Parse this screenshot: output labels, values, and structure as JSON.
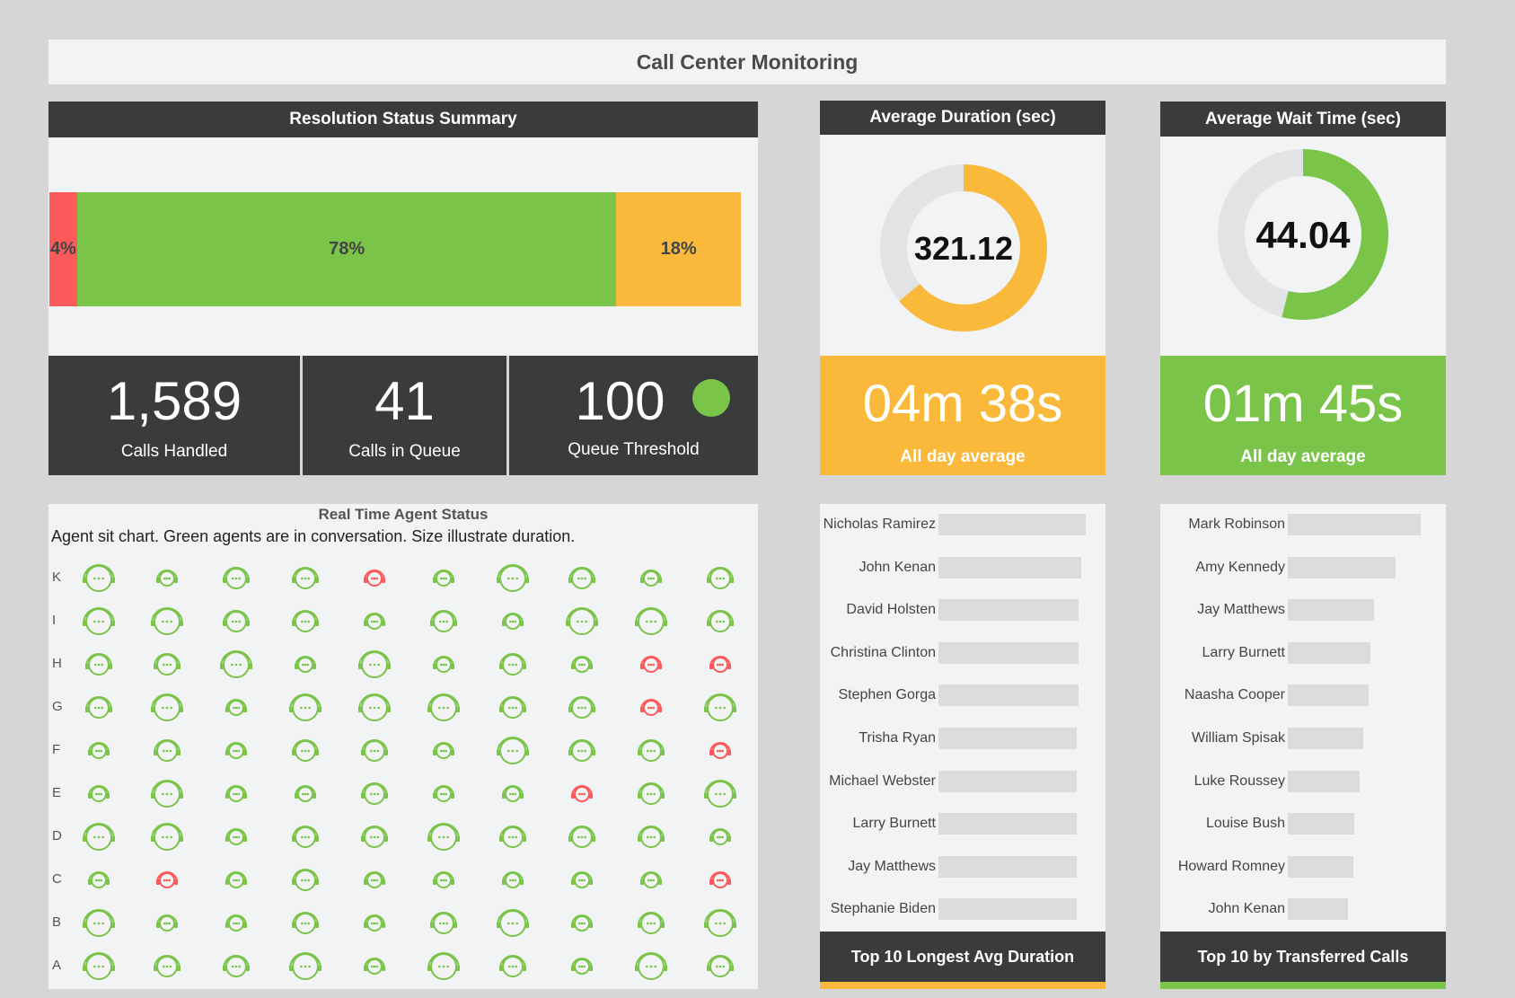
{
  "page_title": "Call Center Monitoring",
  "resolution": {
    "title": "Resolution Status Summary",
    "segments": [
      {
        "label": "4%",
        "value": 4,
        "color": "#fc5a5a"
      },
      {
        "label": "78%",
        "value": 78,
        "color": "#7ac44a"
      },
      {
        "label": "18%",
        "value": 18,
        "color": "#fbb93b"
      }
    ]
  },
  "kpis": {
    "calls_handled": {
      "value": "1,589",
      "label": "Calls Handled"
    },
    "calls_in_queue": {
      "value": "41",
      "label": "Calls in Queue"
    },
    "queue_threshold": {
      "value": "100",
      "label": "Queue Threshold",
      "status_color": "#7ac44a"
    }
  },
  "avg_duration": {
    "title": "Average Duration (sec)",
    "value": "321.12",
    "fraction": 0.64,
    "color": "#fbb93b",
    "time": "04m 38s",
    "time_label": "All day average"
  },
  "avg_wait": {
    "title": "Average Wait Time (sec)",
    "value": "44.04",
    "fraction": 0.54,
    "color": "#7ac44a",
    "time": "01m 45s",
    "time_label": "All day average"
  },
  "agents": {
    "title": "Real Time Agent Status",
    "subtitle": "Agent sit chart. Green agents are in conversation. Size illustrate duration.",
    "rows": [
      "K",
      "I",
      "H",
      "G",
      "F",
      "E",
      "D",
      "C",
      "B",
      "A"
    ],
    "grid": [
      [
        [
          "g",
          3
        ],
        [
          "g",
          1
        ],
        [
          "g",
          2
        ],
        [
          "g",
          2
        ],
        [
          "r",
          1
        ],
        [
          "g",
          1
        ],
        [
          "g",
          3
        ],
        [
          "g",
          2
        ],
        [
          "g",
          1
        ],
        [
          "g",
          2
        ]
      ],
      [
        [
          "g",
          3
        ],
        [
          "g",
          3
        ],
        [
          "g",
          2
        ],
        [
          "g",
          2
        ],
        [
          "g",
          1
        ],
        [
          "g",
          2
        ],
        [
          "g",
          1
        ],
        [
          "g",
          3
        ],
        [
          "g",
          3
        ],
        [
          "g",
          2
        ]
      ],
      [
        [
          "g",
          2
        ],
        [
          "g",
          2
        ],
        [
          "g",
          3
        ],
        [
          "g",
          1
        ],
        [
          "g",
          3
        ],
        [
          "g",
          1
        ],
        [
          "g",
          2
        ],
        [
          "g",
          1
        ],
        [
          "r",
          1
        ],
        [
          "r",
          1
        ]
      ],
      [
        [
          "g",
          2
        ],
        [
          "g",
          3
        ],
        [
          "g",
          1
        ],
        [
          "g",
          3
        ],
        [
          "g",
          3
        ],
        [
          "g",
          3
        ],
        [
          "g",
          2
        ],
        [
          "g",
          2
        ],
        [
          "r",
          1
        ],
        [
          "g",
          3
        ]
      ],
      [
        [
          "g",
          1
        ],
        [
          "g",
          2
        ],
        [
          "g",
          1
        ],
        [
          "g",
          2
        ],
        [
          "g",
          2
        ],
        [
          "g",
          1
        ],
        [
          "g",
          3
        ],
        [
          "g",
          2
        ],
        [
          "g",
          2
        ],
        [
          "r",
          1
        ]
      ],
      [
        [
          "g",
          1
        ],
        [
          "g",
          3
        ],
        [
          "g",
          1
        ],
        [
          "g",
          1
        ],
        [
          "g",
          2
        ],
        [
          "g",
          1
        ],
        [
          "g",
          1
        ],
        [
          "r",
          1
        ],
        [
          "g",
          2
        ],
        [
          "g",
          3
        ]
      ],
      [
        [
          "g",
          3
        ],
        [
          "g",
          3
        ],
        [
          "g",
          1
        ],
        [
          "g",
          2
        ],
        [
          "g",
          2
        ],
        [
          "g",
          3
        ],
        [
          "g",
          2
        ],
        [
          "g",
          2
        ],
        [
          "g",
          2
        ],
        [
          "g",
          1
        ]
      ],
      [
        [
          "g",
          1
        ],
        [
          "r",
          1
        ],
        [
          "g",
          1
        ],
        [
          "g",
          2
        ],
        [
          "g",
          1
        ],
        [
          "g",
          1
        ],
        [
          "g",
          1
        ],
        [
          "g",
          1
        ],
        [
          "g",
          1
        ],
        [
          "r",
          1
        ]
      ],
      [
        [
          "g",
          3
        ],
        [
          "g",
          1
        ],
        [
          "g",
          1
        ],
        [
          "g",
          2
        ],
        [
          "g",
          1
        ],
        [
          "g",
          2
        ],
        [
          "g",
          3
        ],
        [
          "g",
          1
        ],
        [
          "g",
          2
        ],
        [
          "g",
          3
        ]
      ],
      [
        [
          "g",
          3
        ],
        [
          "g",
          2
        ],
        [
          "g",
          2
        ],
        [
          "g",
          3
        ],
        [
          "g",
          1
        ],
        [
          "g",
          3
        ],
        [
          "g",
          2
        ],
        [
          "g",
          1
        ],
        [
          "g",
          3
        ],
        [
          "g",
          2
        ]
      ]
    ]
  },
  "longest_duration": {
    "title": "Top 10 Longest Avg Duration",
    "accent": "#fbb93b",
    "items": [
      {
        "name": "Nicholas Ramirez",
        "value": 1.0
      },
      {
        "name": "John Kenan",
        "value": 0.97
      },
      {
        "name": "David Holsten",
        "value": 0.95
      },
      {
        "name": "Christina Clinton",
        "value": 0.95
      },
      {
        "name": "Stephen Gorga",
        "value": 0.95
      },
      {
        "name": "Trisha Ryan",
        "value": 0.94
      },
      {
        "name": "Michael Webster",
        "value": 0.94
      },
      {
        "name": "Larry Burnett",
        "value": 0.94
      },
      {
        "name": "Jay Matthews",
        "value": 0.94
      },
      {
        "name": "Stephanie Biden",
        "value": 0.94
      }
    ]
  },
  "transferred": {
    "title": "Top 10 by Transferred Calls",
    "accent": "#7ac44a",
    "items": [
      {
        "name": "Mark Robinson",
        "value": 1.0
      },
      {
        "name": "Amy Kennedy",
        "value": 0.81
      },
      {
        "name": "Jay Matthews",
        "value": 0.65
      },
      {
        "name": "Larry Burnett",
        "value": 0.62
      },
      {
        "name": "Naasha Cooper",
        "value": 0.61
      },
      {
        "name": "William Spisak",
        "value": 0.57
      },
      {
        "name": "Luke Roussey",
        "value": 0.54
      },
      {
        "name": "Louise Bush",
        "value": 0.5
      },
      {
        "name": "Howard Romney",
        "value": 0.49
      },
      {
        "name": "John Kenan",
        "value": 0.45
      }
    ]
  }
}
